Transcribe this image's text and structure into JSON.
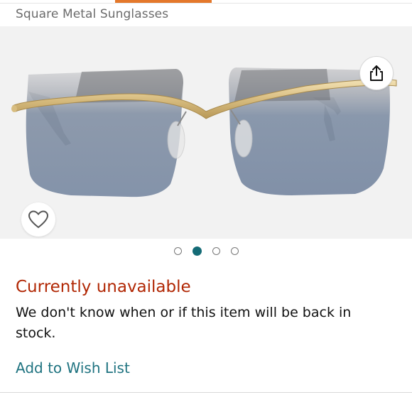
{
  "product": {
    "title": "Square Metal Sunglasses"
  },
  "gallery": {
    "image_icon": "sunglasses-product-photo",
    "share_icon": "share-icon",
    "wishlist_icon": "heart-outline-icon",
    "image_count": 4,
    "active_index": 2
  },
  "availability": {
    "status": "Currently unavailable",
    "note": "We don't know when or if this item will be back in stock."
  },
  "actions": {
    "add_to_wishlist": "Add to Wish List"
  },
  "colors": {
    "accent_orange": "#e4782b",
    "unavailable_red": "#b12704",
    "link_teal": "#1f7380",
    "active_dot": "#146b76"
  }
}
